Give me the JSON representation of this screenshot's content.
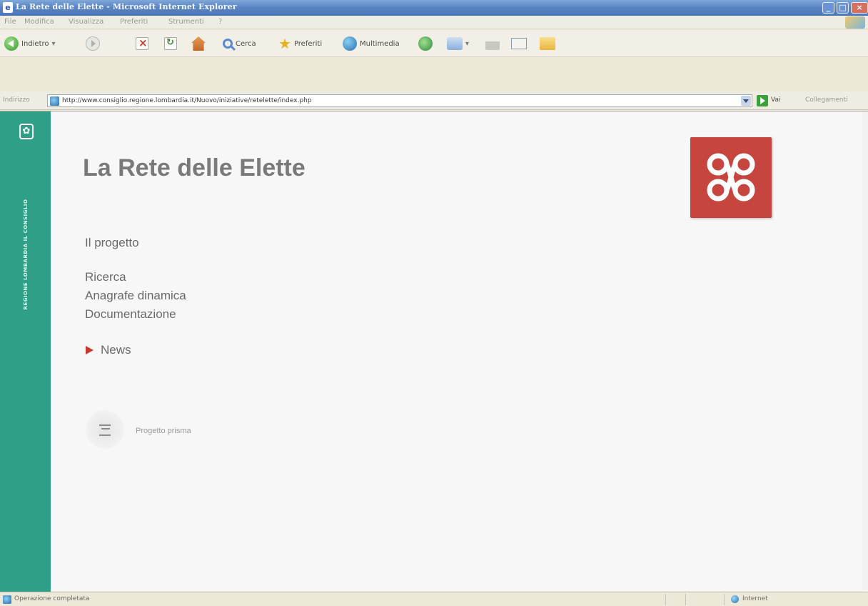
{
  "window": {
    "title": "La Rete delle Elette - Microsoft Internet Explorer",
    "controls": {
      "minimize": "_",
      "maximize": "□",
      "close": "×"
    }
  },
  "menu": [
    "File",
    "Modifica",
    "Visualizza",
    "Preferiti",
    "Strumenti",
    "?"
  ],
  "toolbar": {
    "back_label": "Indietro",
    "search_label": "Cerca",
    "favorites_label": "Preferiti",
    "media_label": "Multimedia"
  },
  "address": {
    "label": "Indirizzo",
    "url": "http://www.consiglio.regione.lombardia.it/Nuovo/iniziative/retelette/index.php",
    "go_label": "Vai",
    "links_label": "Collegamenti"
  },
  "sidebar": {
    "vertical_text": "REGIONE LOMBARDIA IL CONSIGLIO"
  },
  "page": {
    "title": "La Rete delle Elette",
    "nav": {
      "progetto": "Il progetto",
      "ricerca": "Ricerca",
      "anagrafe": "Anagrafe dinamica",
      "documentazione": "Documentazione",
      "news": "News"
    },
    "prisma_label": "Progetto prisma"
  },
  "status": {
    "text": "Operazione completata",
    "zone": "Internet"
  },
  "colors": {
    "sidebar_green": "#2f9f87",
    "logo_red": "#c6453e",
    "news_arrow": "#c63a2e"
  }
}
